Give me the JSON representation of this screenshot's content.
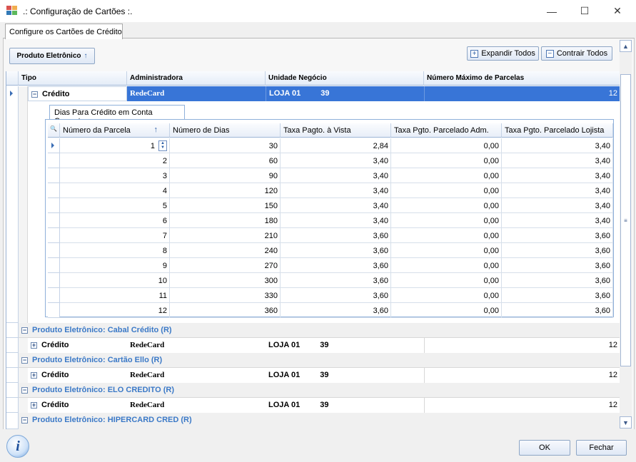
{
  "window": {
    "title": ".: Configuração de Cartões :.",
    "minimize_glyph": "—",
    "maximize_glyph": "☐",
    "close_glyph": "✕"
  },
  "tab": {
    "label": "Configure os Cartões de Crédito"
  },
  "toolbar": {
    "group_button": "Produto Eletrônico",
    "group_arrow": "↑",
    "expand_all": "Expandir Todos",
    "collapse_all": "Contrair Todos"
  },
  "grid": {
    "headers": [
      "Tipo",
      "Administradora",
      "Unidade Negócio",
      "Número Máximo de Parcelas"
    ],
    "first_row": {
      "tipo": "Crédito",
      "admin": "RedeCard",
      "unidade": "LOJA 01",
      "unidade_tail": "39",
      "max": "12"
    },
    "groups": [
      {
        "title": "Produto Eletrônico: Cabal Crédito (R)",
        "tipo": "Crédito",
        "admin": "RedeCard",
        "unidade": "LOJA 01",
        "unidade_tail": "39",
        "max": "12"
      },
      {
        "title": "Produto Eletrônico: Cartão Ello (R)",
        "tipo": "Crédito",
        "admin": "RedeCard",
        "unidade": "LOJA 01",
        "unidade_tail": "39",
        "max": "12"
      },
      {
        "title": "Produto Eletrônico: ELO CREDITO (R)",
        "tipo": "Crédito",
        "admin": "RedeCard",
        "unidade": "LOJA 01",
        "unidade_tail": "39",
        "max": "12"
      },
      {
        "title": "Produto Eletrônico: HIPERCARD CRED (R)"
      }
    ],
    "expand_glyph": "+",
    "collapse_glyph": "−"
  },
  "subgrid": {
    "tab_label": "Dias Para Crédito em Conta Corrente",
    "search_glyph": "🔍",
    "sort_glyph": "↑",
    "headers": [
      "Número da Parcela",
      "Número de Dias",
      "Taxa Pagto. à Vista",
      "Taxa Pgto. Parcelado Adm.",
      "Taxa Pgto. Parcelado Lojista"
    ],
    "rows": [
      [
        "1",
        "30",
        "2,84",
        "0,00",
        "3,40"
      ],
      [
        "2",
        "60",
        "3,40",
        "0,00",
        "3,40"
      ],
      [
        "3",
        "90",
        "3,40",
        "0,00",
        "3,40"
      ],
      [
        "4",
        "120",
        "3,40",
        "0,00",
        "3,40"
      ],
      [
        "5",
        "150",
        "3,40",
        "0,00",
        "3,40"
      ],
      [
        "6",
        "180",
        "3,40",
        "0,00",
        "3,40"
      ],
      [
        "7",
        "210",
        "3,60",
        "0,00",
        "3,60"
      ],
      [
        "8",
        "240",
        "3,60",
        "0,00",
        "3,60"
      ],
      [
        "9",
        "270",
        "3,60",
        "0,00",
        "3,60"
      ],
      [
        "10",
        "300",
        "3,60",
        "0,00",
        "3,60"
      ],
      [
        "11",
        "330",
        "3,60",
        "0,00",
        "3,60"
      ],
      [
        "12",
        "360",
        "3,60",
        "0,00",
        "3,60"
      ]
    ]
  },
  "footer": {
    "ok": "OK",
    "close": "Fechar",
    "info_glyph": "i"
  },
  "colors": {
    "accent": "#3875d7",
    "group_text": "#3b79c7",
    "border": "#9db5d6"
  }
}
